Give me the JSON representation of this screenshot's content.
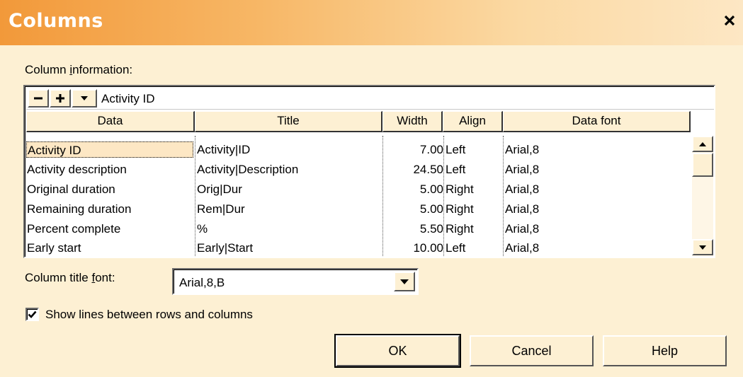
{
  "window": {
    "title": "Columns",
    "close_glyph": "×"
  },
  "column_info": {
    "label_pre": "Column ",
    "label_accel": "i",
    "label_post": "nformation:",
    "toolbar": {
      "remove_glyph": "−",
      "add_glyph": "+",
      "edit_value": "Activity ID"
    },
    "headers": [
      "Data",
      "Title",
      "Width",
      "Align",
      "Data font"
    ],
    "rows": [
      {
        "data": "Activity ID",
        "title": "Activity|ID",
        "width": "7.00",
        "align": "Left",
        "font": "Arial,8",
        "selected": true
      },
      {
        "data": "Activity description",
        "title": "Activity|Description",
        "width": "24.50",
        "align": "Left",
        "font": "Arial,8",
        "selected": false
      },
      {
        "data": "Original duration",
        "title": "Orig|Dur",
        "width": "5.00",
        "align": "Right",
        "font": "Arial,8",
        "selected": false
      },
      {
        "data": "Remaining duration",
        "title": "Rem|Dur",
        "width": "5.00",
        "align": "Right",
        "font": "Arial,8",
        "selected": false
      },
      {
        "data": "Percent complete",
        "title": "%",
        "width": "5.50",
        "align": "Right",
        "font": "Arial,8",
        "selected": false
      },
      {
        "data": "Early start",
        "title": "Early|Start",
        "width": "10.00",
        "align": "Left",
        "font": "Arial,8",
        "selected": false
      }
    ]
  },
  "title_font": {
    "label_pre": "Column title ",
    "label_accel": "f",
    "label_post": "ont:",
    "value": "Arial,8,B"
  },
  "show_lines": {
    "label": "Show lines between rows and columns",
    "checked": true
  },
  "buttons": {
    "ok": "OK",
    "cancel": "Cancel",
    "help": "Help"
  },
  "colors": {
    "dialog_bg": "#fdf0d3",
    "title_gradient_start": "#f2993a",
    "title_gradient_end": "#fde7c4"
  },
  "icons": [
    "close-icon",
    "minus-icon",
    "plus-icon",
    "dropdown-arrow-icon",
    "scroll-up-icon",
    "scroll-down-icon",
    "checkmark-icon"
  ]
}
